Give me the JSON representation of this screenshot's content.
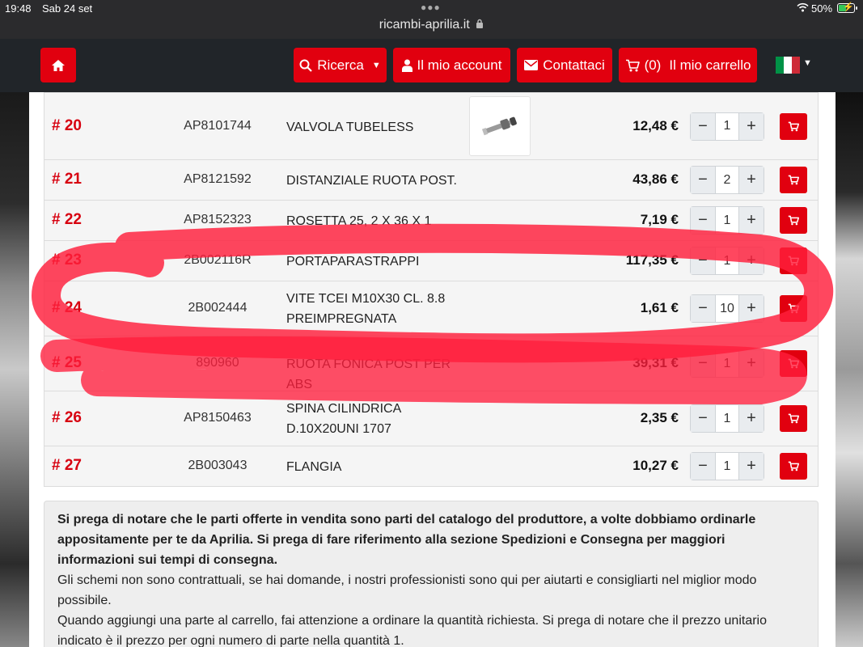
{
  "status_bar": {
    "time": "19:48",
    "date": "Sab 24 set",
    "battery": "50%",
    "battery_level": 0.5
  },
  "browser": {
    "url": "ricambi-aprilia.it"
  },
  "navbar": {
    "search_label": "Ricerca",
    "account_label": "Il mio account",
    "contact_label": "Contattaci",
    "cart_count": "(0)",
    "cart_label": "Il mio carrello",
    "language": "italian-flag",
    "accent_color": "#e1000f"
  },
  "parts": [
    {
      "num": "# 20",
      "code": "AP8101744",
      "desc": "VALVOLA TUBELESS",
      "price": "12,48 €",
      "qty": "1"
    },
    {
      "num": "# 21",
      "code": "AP8121592",
      "desc": "DISTANZIALE RUOTA POST.",
      "price": "43,86 €",
      "qty": "2"
    },
    {
      "num": "# 22",
      "code": "AP8152323",
      "desc": "ROSETTA 25, 2 X 36 X 1",
      "price": "7,19 €",
      "qty": "1"
    },
    {
      "num": "# 23",
      "code": "2B002116R",
      "desc": "PORTAPARASTRAPPI",
      "price": "117,35 €",
      "qty": "1"
    },
    {
      "num": "# 24",
      "code": "2B002444",
      "desc": "VITE TCEI M10X30 CL. 8.8 PREIMPREGNATA",
      "price": "1,61 €",
      "qty": "10"
    },
    {
      "num": "# 25",
      "code": "890960",
      "desc": "RUOTA FONICA POST PER ABS",
      "price": "39,31 €",
      "qty": "1"
    },
    {
      "num": "# 26",
      "code": "AP8150463",
      "desc": "SPINA CILINDRICA D.10X20UNI 1707",
      "price": "2,35 €",
      "qty": "1"
    },
    {
      "num": "# 27",
      "code": "2B003043",
      "desc": "FLANGIA",
      "price": "10,27 €",
      "qty": "1"
    }
  ],
  "info": {
    "bold_text": "Si prega di notare che le parti offerte in vendita sono parti del catalogo del produttore, a volte dobbiamo ordinarle appositamente per te da Aprilia. Si prega di fare riferimento alla sezione Spedizioni e Consegna per maggiori informazioni sui tempi di consegna.",
    "text_1": "Gli schemi non sono contrattuali, se hai domande, i nostri professionisti sono qui per aiutarti e consigliarti nel miglior modo possibile.",
    "text_2": "Quando aggiungi una parte al carrello, fai attenzione a ordinare la quantità richiesta. Si prega di notare che il prezzo unitario indicato è il prezzo per ogni numero di parte nella quantità 1."
  }
}
